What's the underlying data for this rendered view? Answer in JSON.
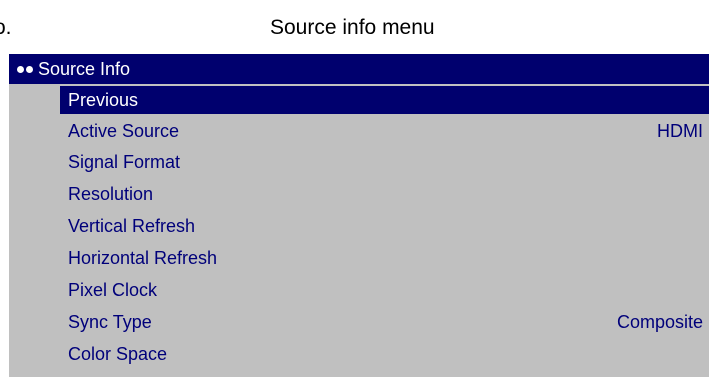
{
  "caption": {
    "prefix": "o.",
    "title": "Source info menu"
  },
  "osd": {
    "header_title": "Source Info",
    "header_icon": "double-dot-icon",
    "colors": {
      "panel": "#c0c0c0",
      "header": "#00006e",
      "item_text": "#00007a",
      "selected_text": "#ffffff"
    },
    "items": [
      {
        "label": "Previous",
        "value": "",
        "selected": true
      },
      {
        "label": "Active Source",
        "value": "HDMI",
        "selected": false
      },
      {
        "label": "Signal Format",
        "value": "",
        "selected": false
      },
      {
        "label": "Resolution",
        "value": "",
        "selected": false
      },
      {
        "label": "Vertical Refresh",
        "value": "",
        "selected": false
      },
      {
        "label": "Horizontal Refresh",
        "value": "",
        "selected": false
      },
      {
        "label": "Pixel Clock",
        "value": "",
        "selected": false
      },
      {
        "label": "Sync Type",
        "value": "Composite",
        "selected": false
      },
      {
        "label": "Color Space",
        "value": "",
        "selected": false
      }
    ]
  }
}
